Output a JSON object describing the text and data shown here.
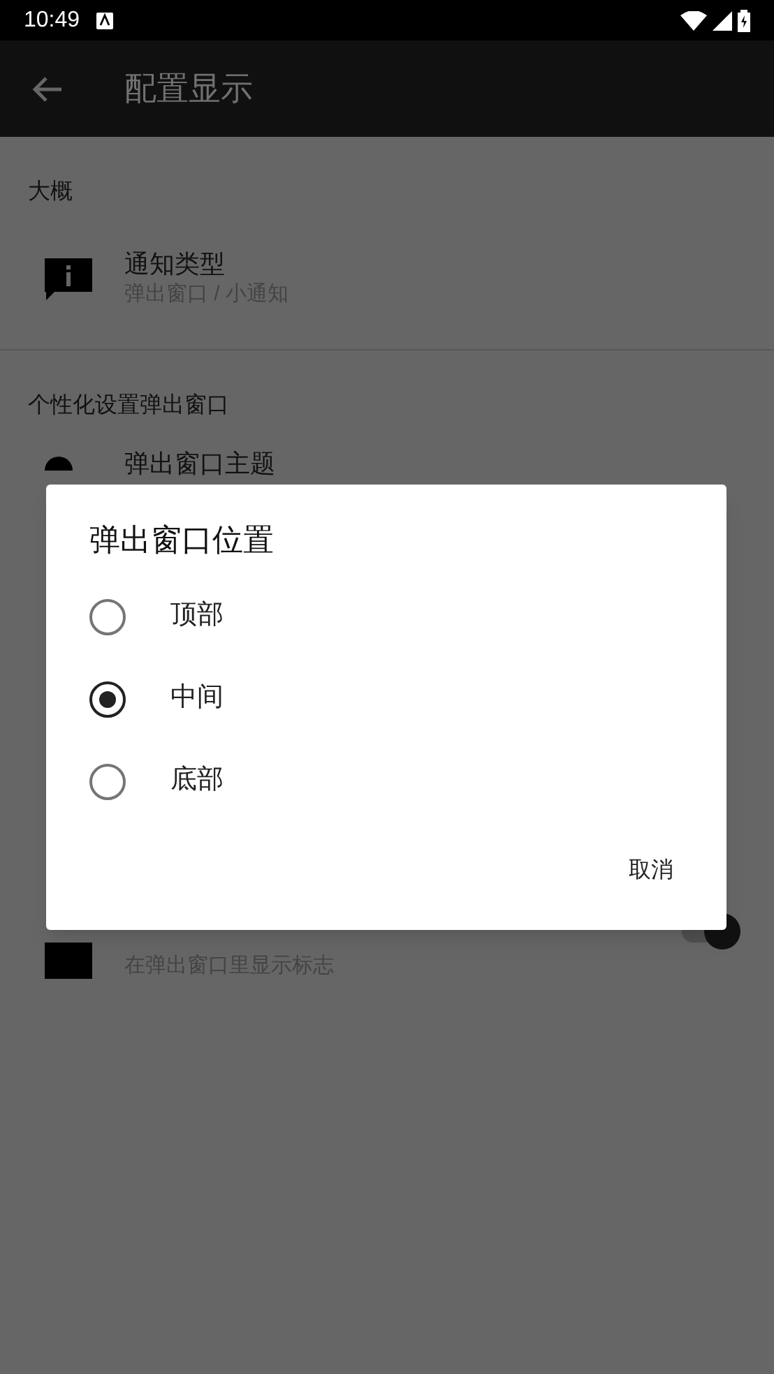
{
  "status_bar": {
    "time": "10:49"
  },
  "app_bar": {
    "title": "配置显示"
  },
  "sections": [
    {
      "header": "大概",
      "items": [
        {
          "kind": "info",
          "title": "通知类型",
          "subtitle": "弹出窗口 / 小通知"
        }
      ]
    },
    {
      "header": "个性化设置弹出窗口",
      "items": [
        {
          "kind": "theme",
          "title": "弹出窗口主题"
        }
      ]
    }
  ],
  "hidden_item": {
    "subtitle": "在弹出窗口里显示标志",
    "on": true
  },
  "dialog": {
    "title": "弹出窗口位置",
    "options": [
      {
        "label": "顶部",
        "selected": false
      },
      {
        "label": "中间",
        "selected": true
      },
      {
        "label": "底部",
        "selected": false
      }
    ],
    "buttons": [
      "取消"
    ]
  }
}
